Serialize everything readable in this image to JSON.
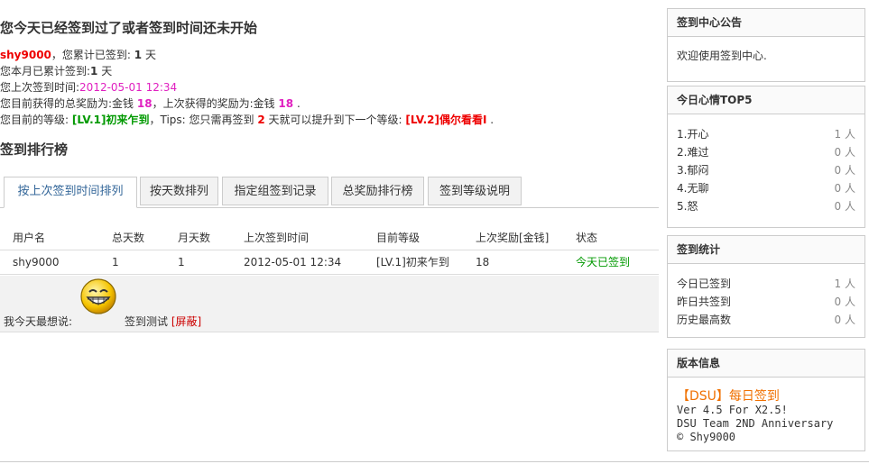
{
  "heading": "您今天已经签到过了或者签到时间还未开始",
  "stats": {
    "username": "shy9000",
    "total_prefix": "，您累计已签到: ",
    "total_days": "1",
    "total_suffix": " 天",
    "month_prefix": "您本月已累计签到:",
    "month_days": "1",
    "month_suffix": " 天",
    "last_prefix": "您上次签到时间:",
    "last_time": "2012-05-01 12:34",
    "reward_prefix": "您目前获得的总奖励为:金钱 ",
    "reward_total": "18",
    "reward_mid": "，上次获得的奖励为:金钱 ",
    "reward_last": "18",
    "reward_end": " .",
    "level_prefix": "您目前的等级: ",
    "level_current": "[LV.1]初来乍到",
    "level_tips": "，Tips: 您只需再签到 ",
    "level_need": "2",
    "level_tips2": " 天就可以提升到下一个等级: ",
    "level_next": "[LV.2]偶尔看看I",
    "level_end": " ."
  },
  "rank_title": "签到排行榜",
  "tabs": [
    "按上次签到时间排列",
    "按天数排列",
    "指定组签到记录",
    "总奖励排行榜",
    "签到等级说明"
  ],
  "table": {
    "headers": [
      "用户名",
      "总天数",
      "月天数",
      "上次签到时间",
      "目前等级",
      "上次奖励[金钱]",
      "状态"
    ],
    "rows": [
      [
        "shy9000",
        "1",
        "1",
        "2012-05-01 12:34",
        "[LV.1]初来乍到",
        "18",
        "今天已签到"
      ]
    ]
  },
  "mood": {
    "label": "我今天最想说:",
    "text": "签到测试",
    "shield": "[屏蔽]",
    "face_icon": "grinning-face-icon"
  },
  "notice": {
    "title": "签到中心公告",
    "body": "欢迎使用签到中心."
  },
  "top5": {
    "title": "今日心情TOP5",
    "items": [
      {
        "name": "1.开心",
        "count": "1 人"
      },
      {
        "name": "2.难过",
        "count": "0 人"
      },
      {
        "name": "3.郁闷",
        "count": "0 人"
      },
      {
        "name": "4.无聊",
        "count": "0 人"
      },
      {
        "name": "5.怒",
        "count": "0 人"
      }
    ]
  },
  "signstats": {
    "title": "签到统计",
    "items": [
      {
        "name": "今日已签到",
        "count": "1 人"
      },
      {
        "name": "昨日共签到",
        "count": "0 人"
      },
      {
        "name": "历史最高数",
        "count": "0 人"
      }
    ]
  },
  "version": {
    "title": "版本信息",
    "product": "【DSU】每日签到",
    "line1": "Ver 4.5 For X2.5!",
    "line2": "DSU Team 2ND Anniversary",
    "line3": "© Shy9000"
  },
  "colors": {
    "accent": "#336699",
    "red": "#ee0000",
    "magenta": "#e020c0",
    "green": "#009900",
    "orange": "#f07000"
  }
}
